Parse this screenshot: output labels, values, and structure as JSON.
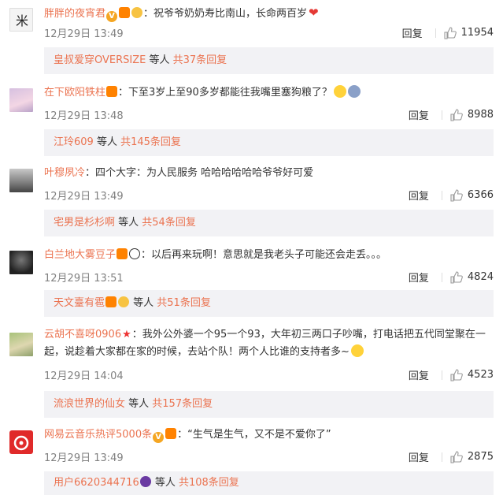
{
  "comments": [
    {
      "name": "胖胖的夜宵君",
      "text": "：祝爷爷奶奶寿比南山，长命两百岁",
      "time": "12月29日 13:49",
      "reply_label": "回复",
      "likes": "11954",
      "reply_preview": {
        "who": "皇叔爱穿OVERSIZE",
        "etc": " 等人 ",
        "total": "共37条回复"
      }
    },
    {
      "name": "在下欧阳铁柱",
      "text": "：下至3岁上至90多岁都能往我嘴里塞狗粮了？",
      "time": "12月29日 13:48",
      "reply_label": "回复",
      "likes": "8988",
      "reply_preview": {
        "who": "江玲609",
        "etc": " 等人 ",
        "total": "共145条回复"
      }
    },
    {
      "name": "叶穆夙冷",
      "text": "：四个大字：为人民服务 哈哈哈哈哈哈爷爷好可爱",
      "time": "12月29日 13:49",
      "reply_label": "回复",
      "likes": "6366",
      "reply_preview": {
        "who": "宅男是杉杉啊",
        "etc": " 等人 ",
        "total": "共54条回复"
      }
    },
    {
      "name": "白兰地大雾豆子",
      "text": "：以后再来玩啊！意思就是我老头子可能还会走丢。。。",
      "time": "12月29日 13:51",
      "reply_label": "回复",
      "likes": "4824",
      "reply_preview": {
        "who": "天文臺有雹",
        "etc": " 等人 ",
        "total": "共51条回复"
      }
    },
    {
      "name": "云胡不喜呀0906",
      "text": "：我外公外婆一个95一个93，大年初三两口子吵嘴，打电话把五代同堂聚在一起，说趁着大家都在家的时候，去站个队！两个人比谁的支持者多~",
      "time": "12月29日 14:04",
      "reply_label": "回复",
      "likes": "4523",
      "reply_preview": {
        "who": "流浪世界的仙女",
        "etc": " 等人 ",
        "total": "共157条回复"
      }
    },
    {
      "name": "网易云音乐热评5000条",
      "text": "：“生气是生气，又不是不爱你了”",
      "time": "12月29日 13:49",
      "reply_label": "回复",
      "likes": "2875",
      "reply_preview": {
        "who": "用户6620344716",
        "etc": " 等人 ",
        "total": "共108条回复"
      }
    }
  ],
  "colors": {
    "name": "#eb7350",
    "meta": "#808080",
    "reply_bg": "#f2f2f5"
  },
  "icons": {
    "like": "thumbs-up-icon"
  }
}
